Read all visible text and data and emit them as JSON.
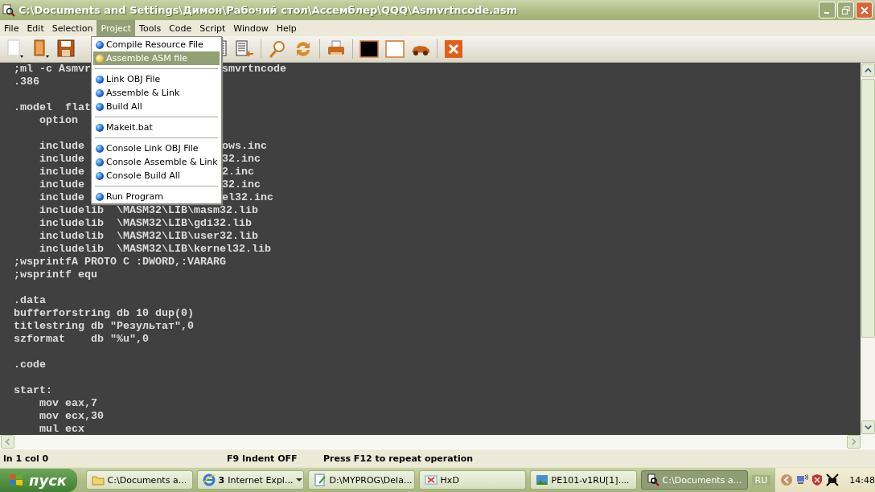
{
  "window": {
    "title": "C:\\Documents and Settings\\Димон\\Рабочий стол\\Ассемблер\\QQQ\\Asmvrtncode.asm"
  },
  "menu_bar": [
    {
      "label": "File",
      "selected": false
    },
    {
      "label": "Edit",
      "selected": false
    },
    {
      "label": "Selection",
      "selected": false
    },
    {
      "label": "Project",
      "selected": true
    },
    {
      "label": "Tools",
      "selected": false
    },
    {
      "label": "Code",
      "selected": false
    },
    {
      "label": "Script",
      "selected": false
    },
    {
      "label": "Window",
      "selected": false
    },
    {
      "label": "Help",
      "selected": false
    }
  ],
  "project_menu": [
    {
      "kind": "item",
      "label": "Compile Resource File",
      "selected": false
    },
    {
      "kind": "item",
      "label": "Assemble ASM file",
      "selected": true
    },
    {
      "kind": "separator"
    },
    {
      "kind": "item",
      "label": "Link OBJ File",
      "selected": false
    },
    {
      "kind": "item",
      "label": "Assemble & Link",
      "selected": false
    },
    {
      "kind": "item",
      "label": "Build All",
      "selected": false
    },
    {
      "kind": "separator"
    },
    {
      "kind": "item",
      "label": "Makeit.bat",
      "selected": false
    },
    {
      "kind": "separator"
    },
    {
      "kind": "item",
      "label": "Console Link OBJ File",
      "selected": false
    },
    {
      "kind": "item",
      "label": "Console Assemble & Link",
      "selected": false
    },
    {
      "kind": "item",
      "label": "Console Build All",
      "selected": false
    },
    {
      "kind": "separator"
    },
    {
      "kind": "item",
      "label": "Run Program",
      "selected": false
    }
  ],
  "editor": {
    "lines": [
      {
        "kind": "code",
        "text": ";ml -c Asmvr",
        "tail": "smvrtncode"
      },
      {
        "kind": "code",
        "text": ".386"
      },
      {
        "kind": "blank"
      },
      {
        "kind": "code",
        "text": ".model  flat"
      },
      {
        "kind": "code",
        "text": "    option"
      },
      {
        "kind": "blank"
      },
      {
        "kind": "code",
        "text": "    include",
        "tail": "ows.inc"
      },
      {
        "kind": "code",
        "text": "    include",
        "tail": "32.inc"
      },
      {
        "kind": "code",
        "text": "    include",
        "tail": "2.inc"
      },
      {
        "kind": "code",
        "text": "    include",
        "tail": "32.inc"
      },
      {
        "kind": "code",
        "text": "    include",
        "tail": "el32.inc"
      },
      {
        "kind": "code",
        "text": "    includelib  \\MASM32\\LIB\\masm32.lib"
      },
      {
        "kind": "code",
        "text": "    includelib  \\MASM32\\LIB\\gdi32.lib"
      },
      {
        "kind": "code",
        "text": "    includelib  \\MASM32\\LIB\\user32.lib"
      },
      {
        "kind": "code",
        "text": "    includelib  \\MASM32\\LIB\\kernel32.lib"
      },
      {
        "kind": "code",
        "text": ";wsprintfA PROTO C :DWORD,:VARARG"
      },
      {
        "kind": "code",
        "text": ";wsprintf equ"
      },
      {
        "kind": "blank"
      },
      {
        "kind": "code",
        "text": ".data"
      },
      {
        "kind": "code",
        "text": "bufferforstring db 10 dup(0)"
      },
      {
        "kind": "code",
        "text": "titlestring db \"Результат\",0"
      },
      {
        "kind": "code",
        "text": "szformat    db \"%u\",0"
      },
      {
        "kind": "blank"
      },
      {
        "kind": "code",
        "text": ".code"
      },
      {
        "kind": "blank"
      },
      {
        "kind": "code",
        "text": "start:"
      },
      {
        "kind": "code",
        "text": "    mov eax,7"
      },
      {
        "kind": "code",
        "text": "    mov ecx,30"
      },
      {
        "kind": "code",
        "text": "    mul ecx"
      }
    ]
  },
  "status_bar": {
    "position": "ln 1 col 0",
    "indent": "F9 Indent OFF",
    "hint": "Press F12 to repeat operation"
  },
  "taskbar": {
    "start": "пуск",
    "buttons": [
      {
        "kind": "folder",
        "label": "C:\\Documents a...",
        "selected": false
      },
      {
        "kind": "browser",
        "count": "3",
        "label": "Internet Expl...",
        "selected": false
      },
      {
        "kind": "notepad",
        "label": "D:\\MYPROG\\Dela...",
        "selected": false
      },
      {
        "kind": "hex",
        "label": "HxD",
        "selected": false
      },
      {
        "kind": "image",
        "label": "PE101-v1RU[1]....",
        "selected": false
      },
      {
        "kind": "editor",
        "label": "C:\\Documents a...",
        "selected": true
      }
    ],
    "language": "RU",
    "clock": "14:48"
  }
}
